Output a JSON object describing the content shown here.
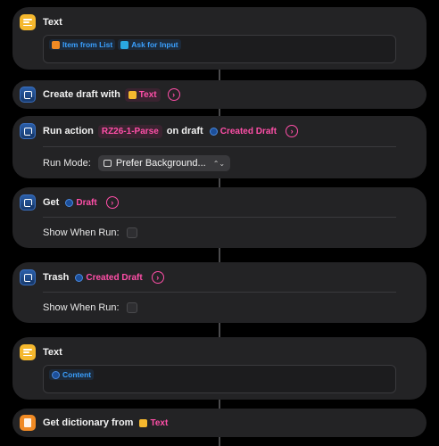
{
  "actions": {
    "text1": {
      "title": "Text",
      "vars": [
        "Item from List",
        "Ask for Input"
      ]
    },
    "create_draft": {
      "title": "Create draft with",
      "param": "Text"
    },
    "run_action": {
      "title": "Run action",
      "action_name": "RZ26-1-Parse",
      "on_label": "on draft",
      "draft_param": "Created Draft",
      "mode_label": "Run Mode:",
      "mode_value": "Prefer Background...",
      "mode_arrows": "⌃⌄"
    },
    "get_draft": {
      "title": "Get",
      "param": "Draft",
      "show_label": "Show When Run:"
    },
    "trash": {
      "title": "Trash",
      "param": "Created Draft",
      "show_label": "Show When Run:"
    },
    "text2": {
      "title": "Text",
      "vars": [
        "Content"
      ]
    },
    "get_dict": {
      "title": "Get dictionary from",
      "param": "Text"
    }
  },
  "chevron": "›",
  "colors": {
    "background": "#000000",
    "card": "#232325",
    "accent_pink": "#ff4fa8",
    "accent_blue": "#3aa0ff",
    "text_icon": "#f5b82e",
    "drafts_icon": "#2a5ea8"
  },
  "icons": [
    "text-app-icon",
    "drafts-app-icon",
    "dictionary-app-icon",
    "chevron-circle-icon",
    "camera-icon",
    "updown-icon",
    "checkbox"
  ]
}
